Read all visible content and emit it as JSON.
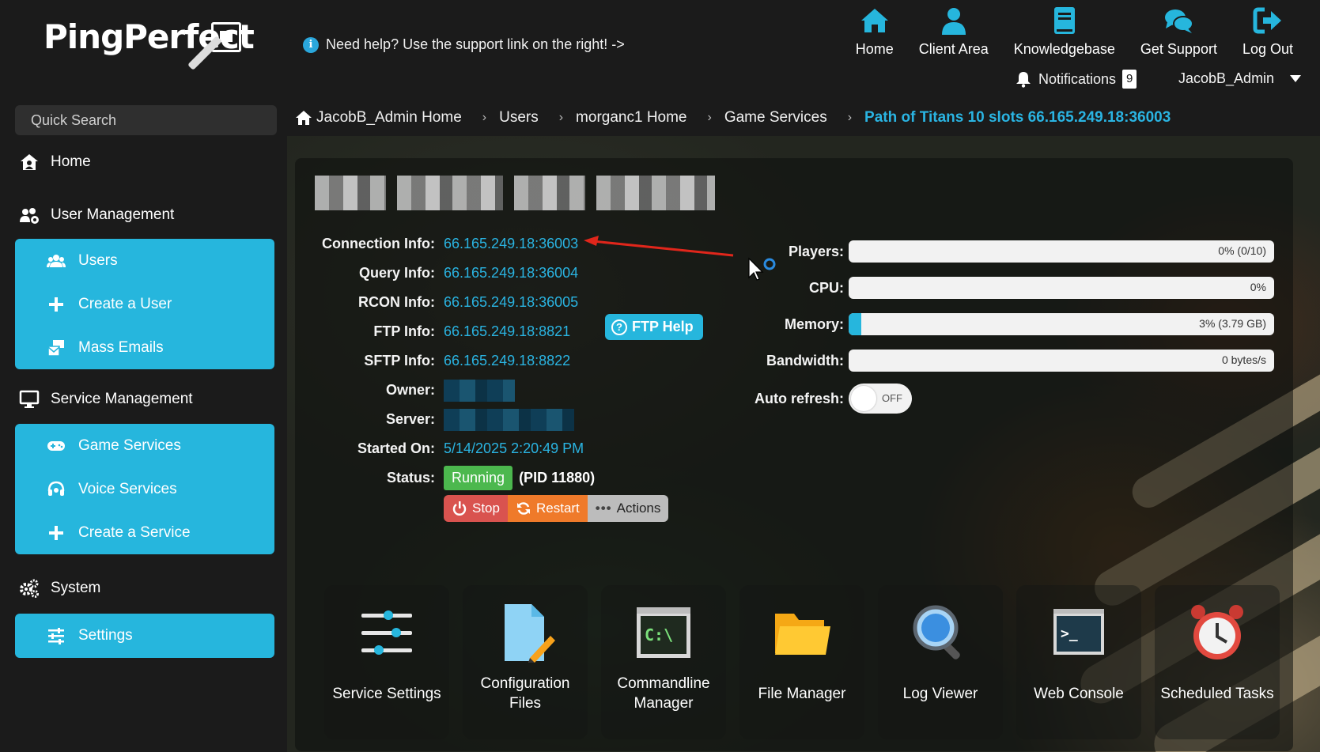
{
  "logo": {
    "text": "PingPerfect"
  },
  "help_text": "Need help? Use the support link on the right! ->",
  "top_nav": [
    {
      "label": "Home",
      "icon": "home-icon"
    },
    {
      "label": "Client Area",
      "icon": "user-icon"
    },
    {
      "label": "Knowledgebase",
      "icon": "book-icon"
    },
    {
      "label": "Get Support",
      "icon": "chat-icon"
    },
    {
      "label": "Log Out",
      "icon": "logout-icon"
    }
  ],
  "notifications": {
    "label": "Notifications",
    "count": "9"
  },
  "user": {
    "name": "JacobB_Admin"
  },
  "search": {
    "placeholder": "Quick Search"
  },
  "sidebar": {
    "home": "Home",
    "user_management": "User Management",
    "user_items": [
      "Users",
      "Create a User",
      "Mass Emails"
    ],
    "service_management": "Service Management",
    "service_items": [
      "Game Services",
      "Voice Services",
      "Create a Service"
    ],
    "system": "System",
    "system_items": [
      "Settings"
    ]
  },
  "breadcrumb": [
    "JacobB_Admin Home",
    "Users",
    "morganc1 Home",
    "Game Services",
    "Path of Titans 10 slots 66.165.249.18:36003"
  ],
  "server_info": {
    "connection_label": "Connection Info:",
    "connection": "66.165.249.18:36003",
    "query_label": "Query Info:",
    "query": "66.165.249.18:36004",
    "rcon_label": "RCON Info:",
    "rcon": "66.165.249.18:36005",
    "ftp_label": "FTP Info:",
    "ftp": "66.165.249.18:8821",
    "ftp_help": "FTP Help",
    "sftp_label": "SFTP Info:",
    "sftp": "66.165.249.18:8822",
    "owner_label": "Owner:",
    "server_label": "Server:",
    "started_label": "Started On:",
    "started": "5/14/2025 2:20:49 PM",
    "status_label": "Status:",
    "status": "Running",
    "pid": "(PID 11880)"
  },
  "actions": {
    "stop": "Stop",
    "restart": "Restart",
    "more": "Actions"
  },
  "stats": {
    "players_label": "Players:",
    "players": "0% (0/10)",
    "players_pct": 0,
    "cpu_label": "CPU:",
    "cpu": "0%",
    "cpu_pct": 0,
    "memory_label": "Memory:",
    "memory": "3% (3.79 GB)",
    "memory_pct": 3,
    "bandwidth_label": "Bandwidth:",
    "bandwidth": "0 bytes/s",
    "bandwidth_pct": 0,
    "auto_refresh_label": "Auto refresh:",
    "auto_refresh": "OFF"
  },
  "tiles": [
    {
      "label": "Service Settings",
      "icon": "sliders-icon"
    },
    {
      "label": "Configuration Files",
      "icon": "file-edit-icon"
    },
    {
      "label": "Commandline Manager",
      "icon": "terminal-c-icon"
    },
    {
      "label": "File Manager",
      "icon": "folder-icon"
    },
    {
      "label": "Log Viewer",
      "icon": "magnifier-icon"
    },
    {
      "label": "Web Console",
      "icon": "console-icon"
    },
    {
      "label": "Scheduled Tasks",
      "icon": "alarm-clock-icon"
    }
  ],
  "colors": {
    "accent": "#26b6dd",
    "link": "#2ab4e2",
    "running": "#4cb84e",
    "stop": "#d9534f",
    "restart": "#ef7a2a"
  }
}
